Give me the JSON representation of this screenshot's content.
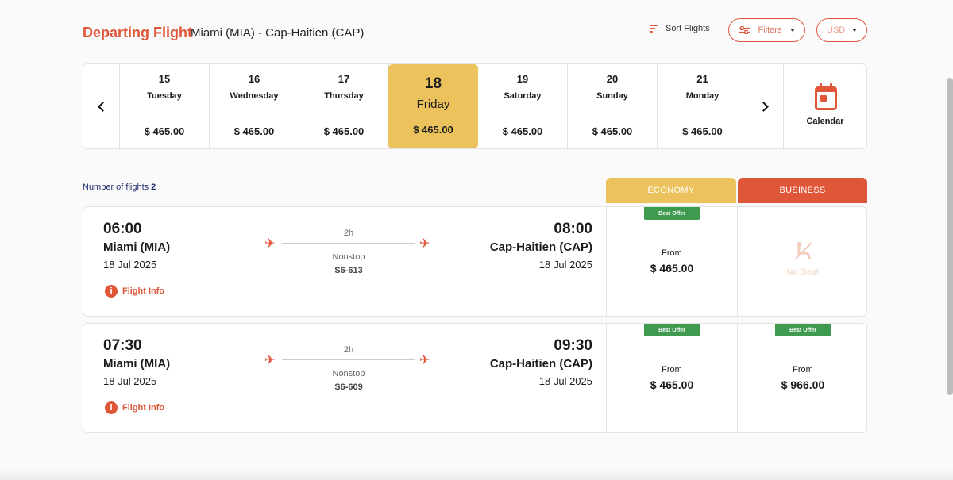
{
  "header": {
    "title": "Departing Flight",
    "route": "Miami (MIA) - Cap-Haitien (CAP)",
    "sort_label": "Sort Flights",
    "filters_label": "Filters",
    "currency": "USD"
  },
  "dates": [
    {
      "day": "15",
      "name": "Tuesday",
      "price": "$ 465.00",
      "selected": false
    },
    {
      "day": "16",
      "name": "Wednesday",
      "price": "$ 465.00",
      "selected": false
    },
    {
      "day": "17",
      "name": "Thursday",
      "price": "$ 465.00",
      "selected": false
    },
    {
      "day": "18",
      "name": "Friday",
      "price": "$ 465.00",
      "selected": true
    },
    {
      "day": "19",
      "name": "Saturday",
      "price": "$ 465.00",
      "selected": false
    },
    {
      "day": "20",
      "name": "Sunday",
      "price": "$ 465.00",
      "selected": false
    },
    {
      "day": "21",
      "name": "Monday",
      "price": "$ 465.00",
      "selected": false
    }
  ],
  "calendar_label": "Calendar",
  "results": {
    "count_label": "Number of flights",
    "count": "2"
  },
  "classes": {
    "economy": "ECONOMY",
    "business": "BUSINESS"
  },
  "flights": [
    {
      "dep_time": "06:00",
      "dep_city": "Miami (MIA)",
      "dep_date": "18 Jul 2025",
      "duration": "2h",
      "stops": "Nonstop",
      "flight_no": "S6-613",
      "arr_time": "08:00",
      "arr_city": "Cap-Haitien (CAP)",
      "arr_date": "18 Jul 2025",
      "info_label": "Flight Info",
      "economy": {
        "badge": "Best Offer",
        "from": "From",
        "price": "$ 465.00"
      },
      "business": {
        "no_seat": "No Seat"
      }
    },
    {
      "dep_time": "07:30",
      "dep_city": "Miami (MIA)",
      "dep_date": "18 Jul 2025",
      "duration": "2h",
      "stops": "Nonstop",
      "flight_no": "S6-609",
      "arr_time": "09:30",
      "arr_city": "Cap-Haitien (CAP)",
      "arr_date": "18 Jul 2025",
      "info_label": "Flight Info",
      "economy": {
        "badge": "Best Offer",
        "from": "From",
        "price": "$ 465.00"
      },
      "business": {
        "badge": "Best Offer",
        "from": "From",
        "price": "$ 966.00"
      }
    }
  ],
  "colors": {
    "accent": "#e05638",
    "economy": "#ecc25c",
    "badge": "#3e9a4f"
  }
}
